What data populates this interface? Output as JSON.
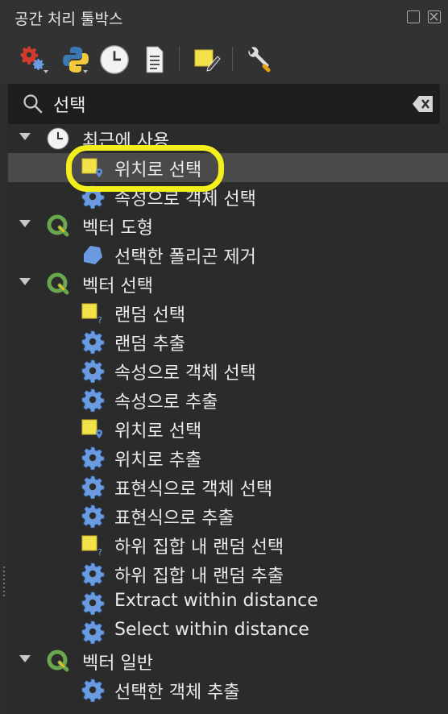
{
  "panel": {
    "title": "공간 처리 툴박스",
    "float_icon": "float-icon",
    "close_icon": "close-icon"
  },
  "toolbar": {
    "icons": [
      "models-gear-icon",
      "python-scripts-icon",
      "history-clock-icon",
      "results-document-icon",
      "edit-features-in-place-icon",
      "options-wrench-icon"
    ]
  },
  "search": {
    "value": "선택",
    "icon": "search-icon",
    "clear_icon": "clear-icon"
  },
  "tree": {
    "groups": [
      {
        "label": "최근에 사용",
        "icon": "clock-icon",
        "items": [
          {
            "label": "위치로 선택",
            "icon": "select-location-icon",
            "selected": true
          },
          {
            "label": "속성으로 객체 선택",
            "icon": "gear-icon"
          }
        ]
      },
      {
        "label": "벡터 도형",
        "icon": "qgis-icon",
        "items": [
          {
            "label": "선택한 폴리곤 제거",
            "icon": "polygon-icon"
          }
        ]
      },
      {
        "label": "벡터 선택",
        "icon": "qgis-icon",
        "items": [
          {
            "label": "랜덤 선택",
            "icon": "select-random-icon"
          },
          {
            "label": "랜덤 추출",
            "icon": "gear-icon"
          },
          {
            "label": "속성으로 객체 선택",
            "icon": "gear-icon"
          },
          {
            "label": "속성으로 추출",
            "icon": "gear-icon"
          },
          {
            "label": "위치로 선택",
            "icon": "select-location-icon"
          },
          {
            "label": "위치로 추출",
            "icon": "gear-icon"
          },
          {
            "label": "표현식으로 객체 선택",
            "icon": "gear-icon"
          },
          {
            "label": "표현식으로 추출",
            "icon": "gear-icon"
          },
          {
            "label": "하위 집합 내 랜덤 선택",
            "icon": "select-random-icon"
          },
          {
            "label": "하위 집합 내 랜덤 추출",
            "icon": "gear-icon"
          },
          {
            "label": "Extract within distance",
            "icon": "gear-icon"
          },
          {
            "label": "Select within distance",
            "icon": "gear-icon"
          }
        ]
      },
      {
        "label": "벡터 일반",
        "icon": "qgis-icon",
        "items": [
          {
            "label": "선택한 객체 추출",
            "icon": "gear-icon"
          }
        ]
      }
    ]
  },
  "colors": {
    "highlight": "#f4ef1c",
    "gear": "#5b8fd6",
    "selection_yellow": "#f3e24a",
    "qgis_green": "#6aa84f"
  }
}
